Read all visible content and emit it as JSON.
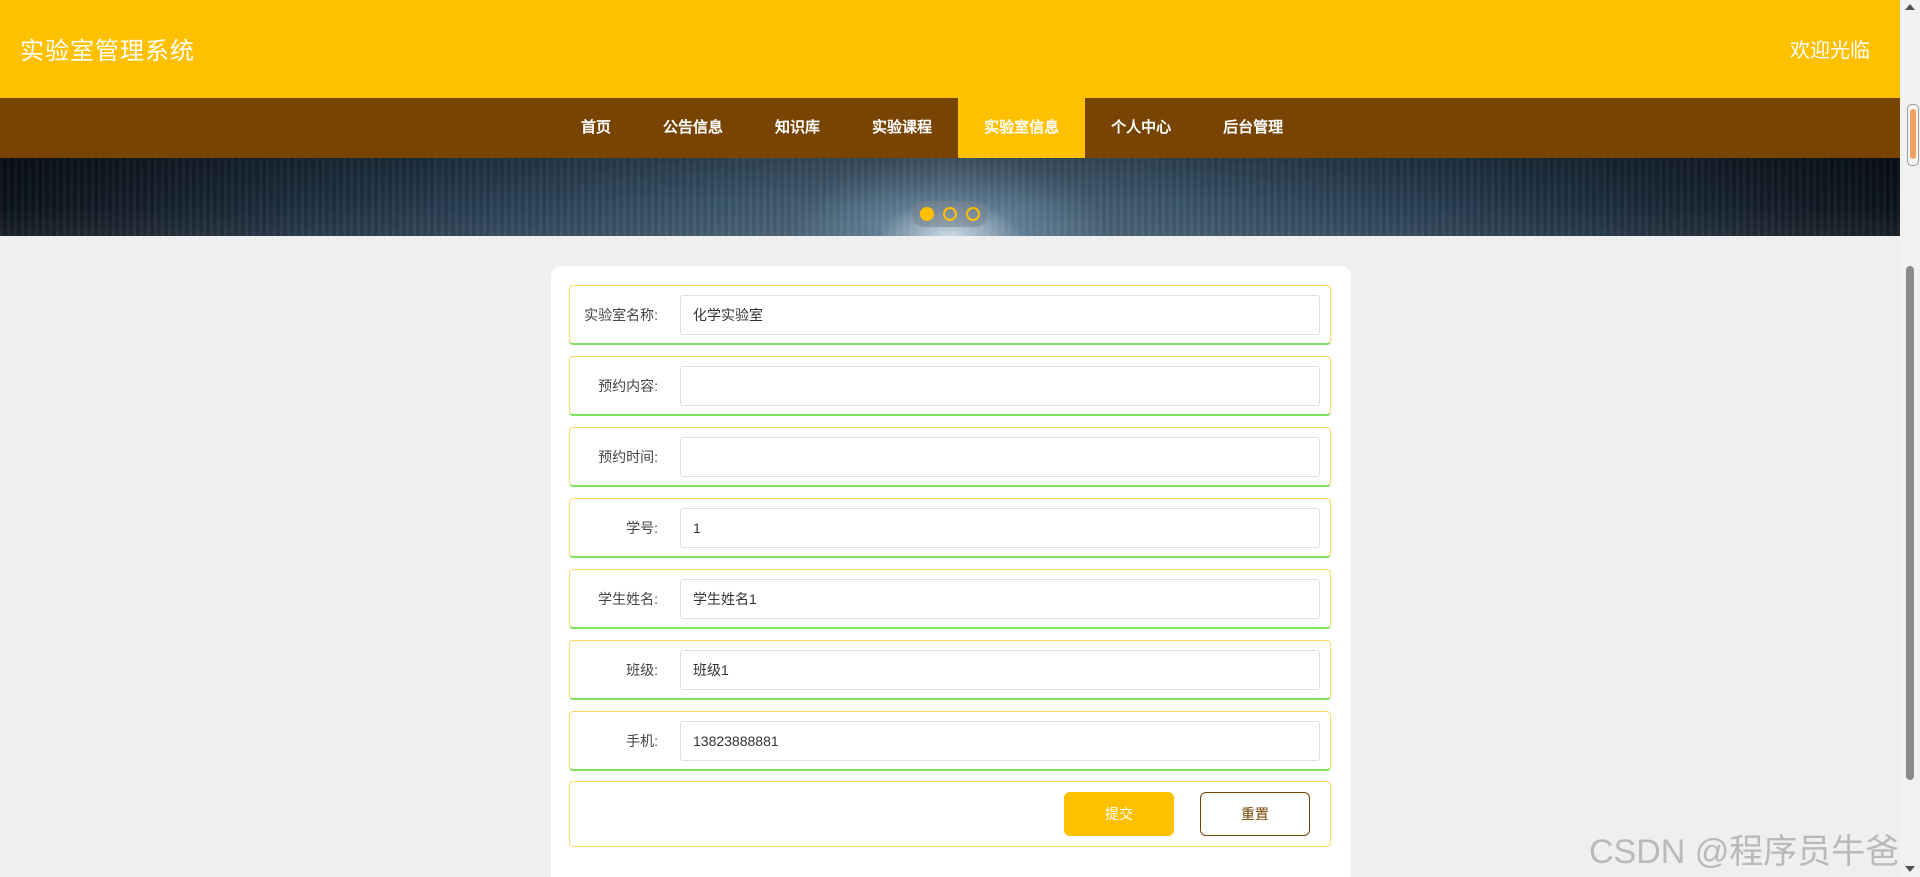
{
  "header": {
    "title": "实验室管理系统",
    "welcome": "欢迎光临"
  },
  "nav": {
    "items": [
      {
        "label": "首页"
      },
      {
        "label": "公告信息"
      },
      {
        "label": "知识库"
      },
      {
        "label": "实验课程"
      },
      {
        "label": "实验室信息"
      },
      {
        "label": "个人中心"
      },
      {
        "label": "后台管理"
      }
    ],
    "active_index": 4
  },
  "banner": {
    "slide_count": 3,
    "active_slide": 1
  },
  "form": {
    "fields": [
      {
        "label": "实验室名称:",
        "value": "化学实验室"
      },
      {
        "label": "预约内容:",
        "value": ""
      },
      {
        "label": "预约时间:",
        "value": ""
      },
      {
        "label": "学号:",
        "value": "1"
      },
      {
        "label": "学生姓名:",
        "value": "学生姓名1"
      },
      {
        "label": "班级:",
        "value": "班级1"
      },
      {
        "label": "手机:",
        "value": "13823888881"
      }
    ],
    "submit_label": "提交",
    "reset_label": "重置"
  },
  "watermark": "CSDN @程序员牛爸",
  "colors": {
    "header_bg": "#ffc000",
    "nav_bg": "#774404",
    "nav_active_bg": "#ffc000",
    "page_bg": "#efefef",
    "row_border": "#ffd966",
    "row_underline": "#7ee25a",
    "reset_border": "#774404"
  }
}
